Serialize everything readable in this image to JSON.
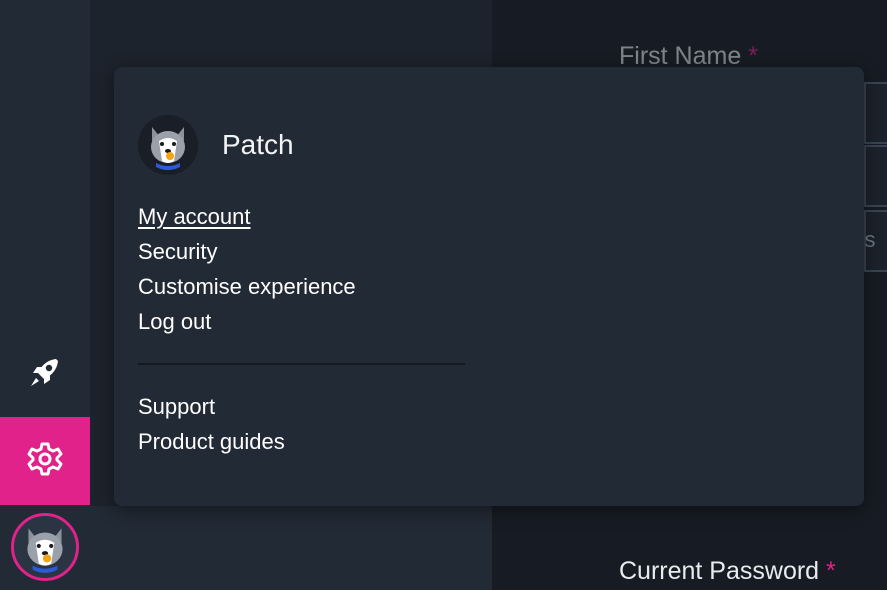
{
  "user": {
    "name": "Patch"
  },
  "account_menu": {
    "items": [
      {
        "label": "My account",
        "active": true
      },
      {
        "label": "Security",
        "active": false
      },
      {
        "label": "Customise experience",
        "active": false
      },
      {
        "label": "Log out",
        "active": false
      }
    ],
    "help_items": [
      {
        "label": "Support"
      },
      {
        "label": "Product guides"
      }
    ]
  },
  "form": {
    "first_name_label": "First Name",
    "current_password_label": "Current Password",
    "required_marker": "*",
    "partial_field_text": "nus"
  },
  "sidebar": {
    "icons": [
      "rocket-icon",
      "gear-icon"
    ],
    "active_item": "settings"
  },
  "colors": {
    "accent": "#e0228a",
    "sidebar_bg": "#222a35",
    "popover_bg": "#222a35",
    "page_bg": "#171c24"
  }
}
